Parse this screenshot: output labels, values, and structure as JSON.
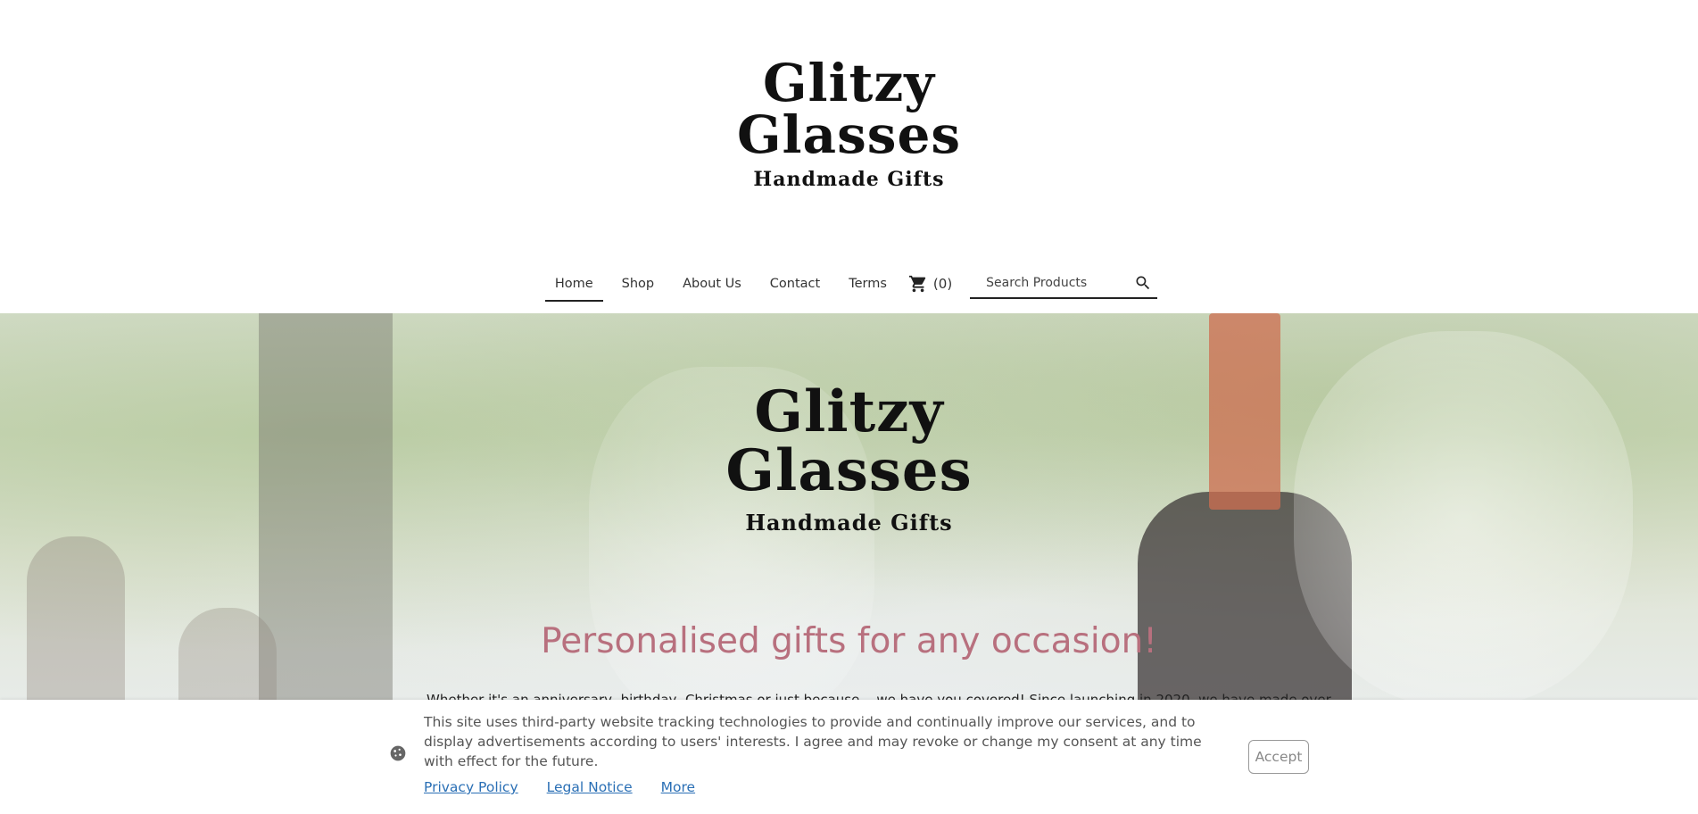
{
  "brand": {
    "line1": "Glitzy",
    "line2": "Glasses",
    "tagline": "Handmade Gifts"
  },
  "nav": {
    "items": [
      {
        "label": "Home",
        "active": true
      },
      {
        "label": "Shop"
      },
      {
        "label": "About Us"
      },
      {
        "label": "Contact"
      },
      {
        "label": "Terms"
      }
    ],
    "cart_count": "(0)",
    "search_placeholder": "Search Products"
  },
  "hero": {
    "heading": "Personalised gifts for any occasion!",
    "text": "Whether it's an anniversary, birthday, Christmas or just because... we have you covered! Since launching in 2020, we have made over"
  },
  "cookie_banner": {
    "message": "This site uses third-party website tracking technologies to provide and continually improve our services, and to display advertisements according to users' interests. I agree and may revoke or change my consent at any time with effect for the future.",
    "links": [
      "Privacy Policy",
      "Legal Notice",
      "More"
    ],
    "accept_label": "Accept"
  },
  "colors": {
    "heading_pink": "#b8707e",
    "link_blue": "#2a6fb5"
  },
  "icons": [
    "cart-icon",
    "search-icon",
    "cookie-icon"
  ]
}
